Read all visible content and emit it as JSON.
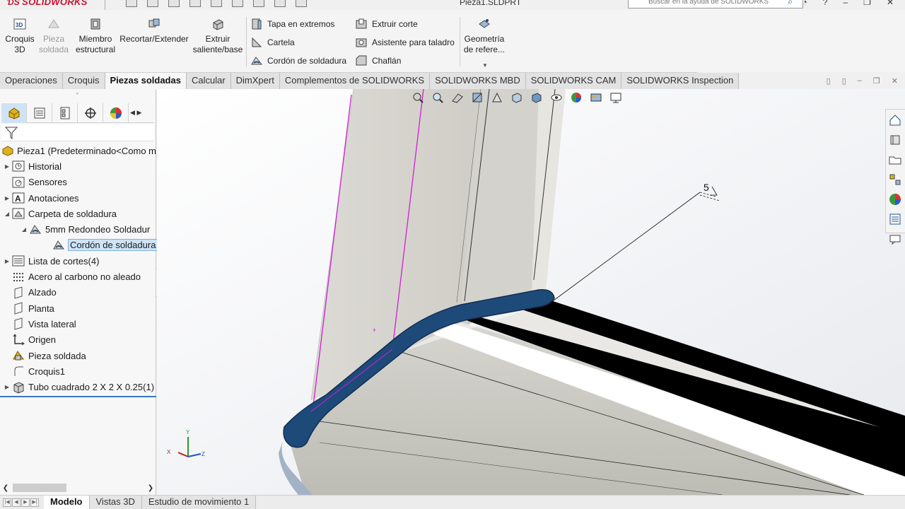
{
  "app": {
    "brand": "SOLIDWORKS",
    "document_title": "Pieza1.SLDPRT",
    "help_search_placeholder": "Buscar en la ayuda de SOLIDWORKS"
  },
  "ribbon": {
    "croquis3d": "Croquis 3D",
    "pieza_soldada": "Pieza soldada",
    "miembro": "Miembro estructural",
    "recortar": "Recortar/Extender",
    "extruir_saliente": "Extruir saliente/base",
    "tapa": "Tapa en extremos",
    "cartela": "Cartela",
    "cordon": "Cordón de soldadura",
    "extruir_corte": "Extruir corte",
    "asistente": "Asistente para taladro",
    "chaflan": "Chaflán",
    "geometria": "Geometría de refere..."
  },
  "command_tabs": [
    "Operaciones",
    "Croquis",
    "Piezas soldadas",
    "Calcular",
    "DimXpert",
    "Complementos de SOLIDWORKS",
    "SOLIDWORKS MBD",
    "SOLIDWORKS CAM",
    "SOLIDWORKS Inspection"
  ],
  "active_command_tab": "Piezas soldadas",
  "tree": {
    "items": [
      {
        "label": "Pieza1  (Predeterminado<Como m",
        "icon": "part-icon"
      },
      {
        "label": "Historial",
        "icon": "history-icon"
      },
      {
        "label": "Sensores",
        "icon": "sensors-icon"
      },
      {
        "label": "Anotaciones",
        "icon": "annotations-icon"
      },
      {
        "label": "Carpeta de soldadura",
        "icon": "weld-folder-icon"
      },
      {
        "label": "5mm Redondeo Soldadur",
        "icon": "weld-bead-group-icon"
      },
      {
        "label": "Cordón de soldadura",
        "icon": "weld-bead-icon"
      },
      {
        "label": "Lista de cortes(4)",
        "icon": "cut-list-icon"
      },
      {
        "label": "Acero al carbono no aleado",
        "icon": "material-icon"
      },
      {
        "label": "Alzado",
        "icon": "plane-icon"
      },
      {
        "label": "Planta",
        "icon": "plane-icon"
      },
      {
        "label": "Vista lateral",
        "icon": "plane-icon"
      },
      {
        "label": "Origen",
        "icon": "origin-icon"
      },
      {
        "label": "Pieza soldada",
        "icon": "weldment-icon"
      },
      {
        "label": "Croquis1",
        "icon": "sketch-icon"
      },
      {
        "label": "Tubo cuadrado 2 X 2 X 0.25(1)",
        "icon": "structural-member-icon"
      }
    ]
  },
  "viewport": {
    "weld_symbol_size": "5",
    "triad_labels": {
      "x": "X",
      "y": "Y",
      "z": "Z"
    }
  },
  "bottom_tabs": [
    "Modelo",
    "Vistas 3D",
    "Estudio de movimiento 1"
  ],
  "colors": {
    "weld_bead": "#1e4a7a",
    "sketch_line": "#d21fd2",
    "selection": "#cde4f7",
    "brand": "#c8102e"
  }
}
